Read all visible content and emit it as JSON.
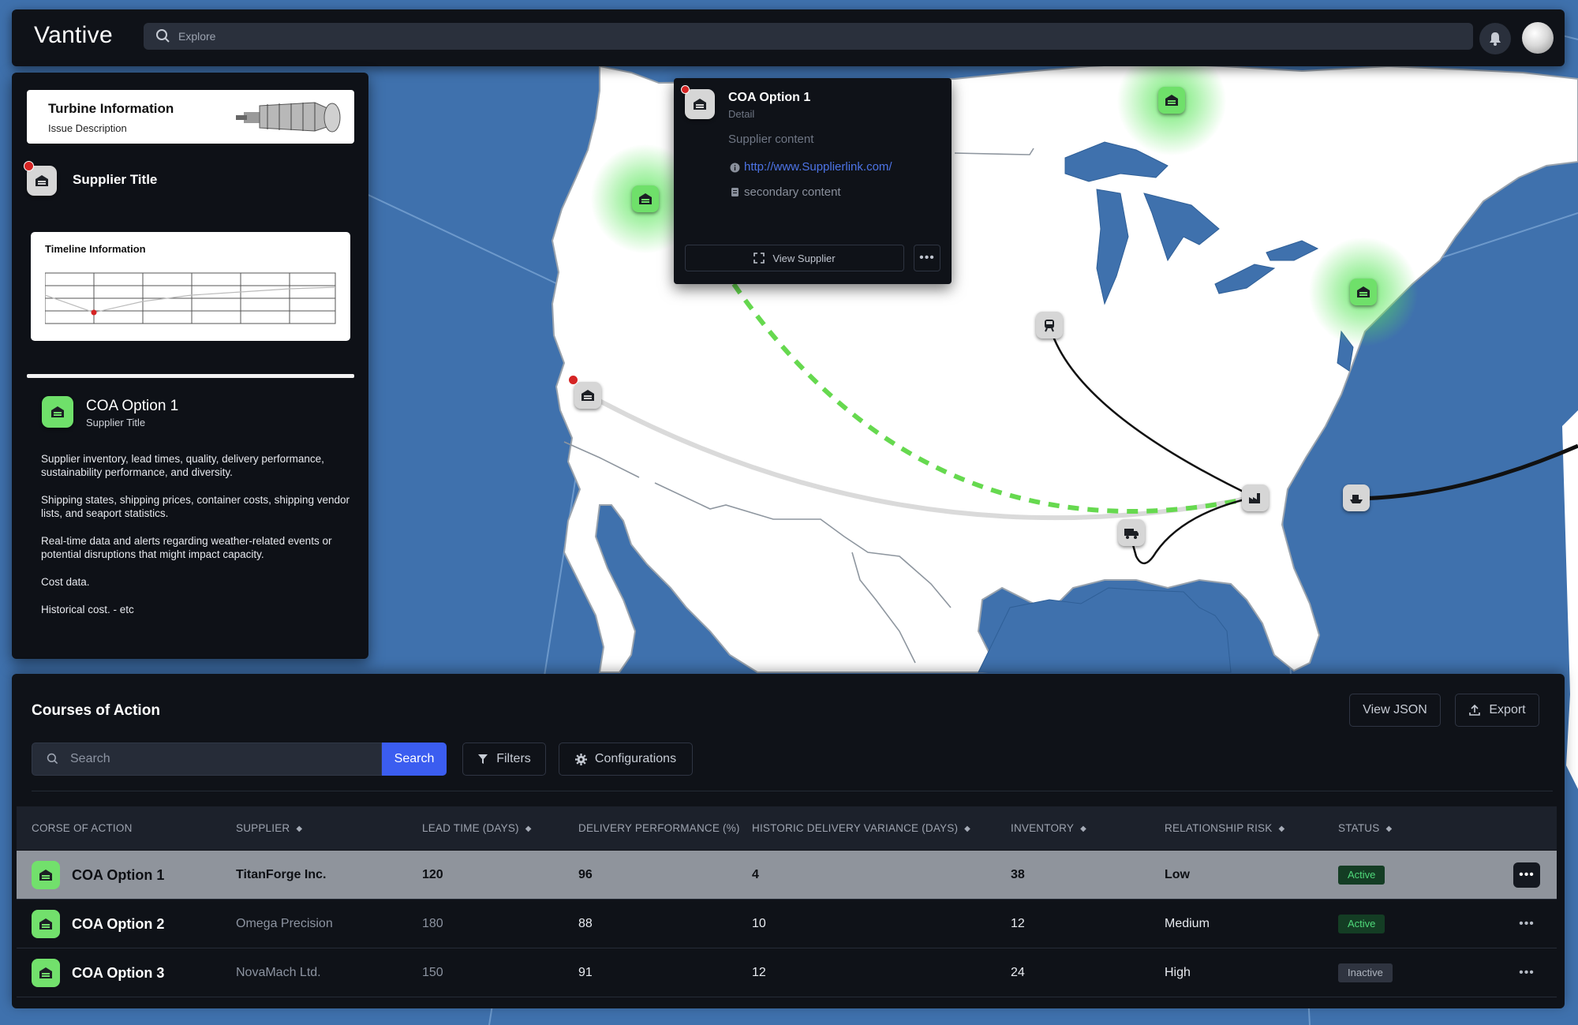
{
  "app": {
    "logo": "Vantive",
    "explore_placeholder": "Explore"
  },
  "left_panel": {
    "turbine": {
      "title": "Turbine Information",
      "subtitle": "Issue Description"
    },
    "supplier_title": "Supplier Title",
    "timeline_label": "Timeline Information",
    "coa": {
      "name": "COA Option 1",
      "subtitle": "Supplier Title"
    },
    "descriptions": [
      "Supplier inventory, lead times, quality, delivery performance, sustainability performance, and diversity.",
      "Shipping states, shipping prices, container costs, shipping vendor lists, and seaport statistics.",
      "Real-time data and alerts regarding weather-related events or potential disruptions that might impact capacity.",
      "Cost data.",
      "Historical cost. - etc"
    ]
  },
  "popup": {
    "title": "COA Option 1",
    "detail": "Detail",
    "content": "Supplier content",
    "link": "http://www.Supplierlink.com/",
    "secondary": "secondary content",
    "view_button": "View Supplier"
  },
  "courses": {
    "title": "Courses of Action",
    "view_json": "View JSON",
    "export": "Export",
    "search_placeholder": "Search",
    "search_button": "Search",
    "filters": "Filters",
    "configurations": "Configurations",
    "columns": [
      "CORSE OF ACTION",
      "SUPPLIER",
      "LEAD TIME (DAYS)",
      "DELIVERY PERFORMANCE (%)",
      "HISTORIC DELIVERY VARIANCE (DAYS)",
      "INVENTORY",
      "RELATIONSHIP RISK",
      "STATUS"
    ],
    "rows": [
      {
        "name": "COA Option 1",
        "supplier": "TitanForge Inc.",
        "lead_time": "120",
        "delivery": "96",
        "variance": "4",
        "inventory": "38",
        "risk": "Low",
        "status": "Active"
      },
      {
        "name": "COA Option 2",
        "supplier": "Omega Precision",
        "lead_time": "180",
        "delivery": "88",
        "variance": "10",
        "inventory": "12",
        "risk": "Medium",
        "status": "Active"
      },
      {
        "name": "COA Option 3",
        "supplier": "NovaMach Ltd.",
        "lead_time": "150",
        "delivery": "91",
        "variance": "12",
        "inventory": "24",
        "risk": "High",
        "status": "Inactive"
      }
    ]
  },
  "colors": {
    "accent_green": "#6fe06a",
    "primary_blue": "#3b5df0",
    "ocean": "#3f71ad",
    "land": "#ffffff",
    "alert_red": "#d52424"
  },
  "icons": {
    "search": "search-icon",
    "bell": "bell-icon",
    "facility": "warehouse-icon",
    "train": "train-icon",
    "truck": "truck-icon",
    "factory": "factory-icon",
    "ship": "ship-icon"
  }
}
